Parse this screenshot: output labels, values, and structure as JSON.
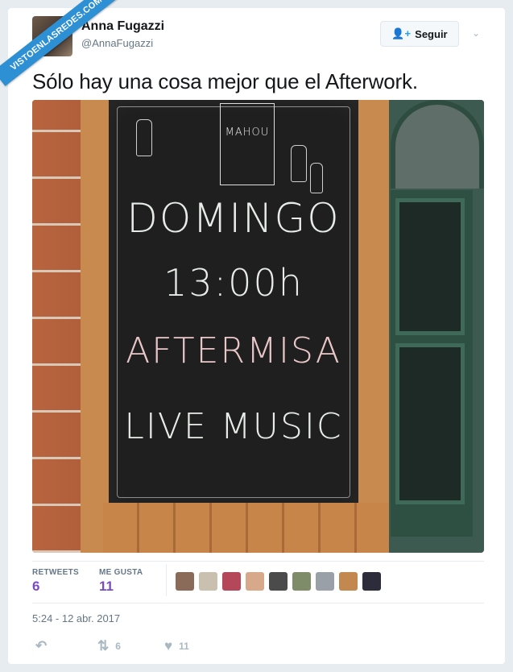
{
  "watermark": "VISTOENLASREDES.COM",
  "author": {
    "name": "Anna Fugazzi",
    "handle": "@AnnaFugazzi"
  },
  "follow_button": {
    "label": "Seguir",
    "icon": "add-user-icon"
  },
  "tweet": {
    "text": "Sólo hay una cosa mejor que el Afterwork."
  },
  "photo": {
    "chalk_lines": [
      "DOMINGO",
      "13:00h",
      "AFTERMISA",
      "LIVE MUSIC"
    ],
    "brand_text": "MAHOU"
  },
  "stats": {
    "retweets_label": "RETWEETS",
    "retweets_value": "6",
    "likes_label": "ME GUSTA",
    "likes_value": "11"
  },
  "likers_colors": [
    "#8a6b5a",
    "#c9c0b0",
    "#b5475a",
    "#d8a88a",
    "#4b4b4b",
    "#7f8c6a",
    "#9aa0a8",
    "#c28850",
    "#2c2c3a"
  ],
  "timestamp": "5:24 - 12 abr. 2017",
  "actions": {
    "reply_icon": "reply-icon",
    "retweet_count": "6",
    "like_count": "11"
  }
}
